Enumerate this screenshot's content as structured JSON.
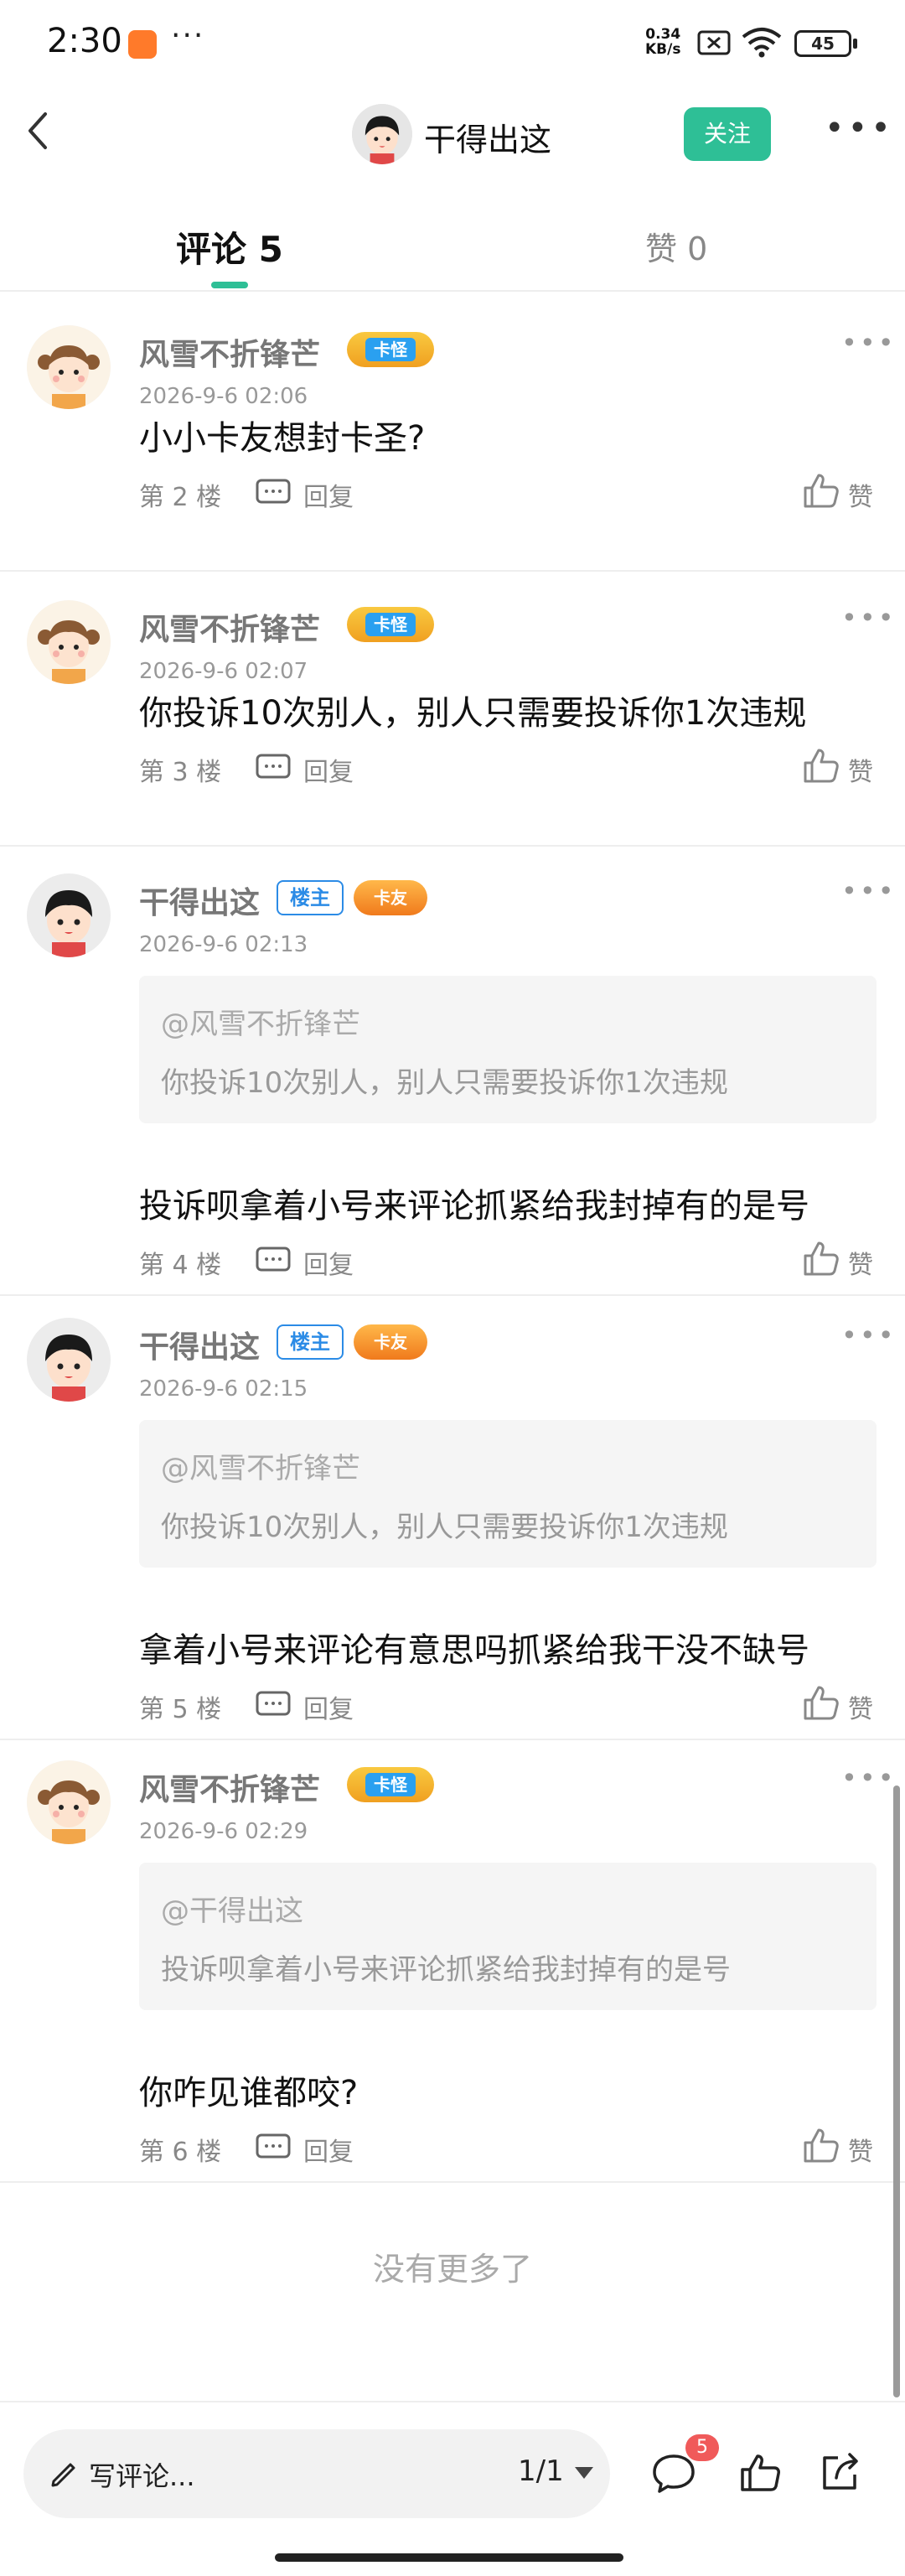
{
  "status_bar": {
    "time": "2:30",
    "dots": "···",
    "net_speed_value": "0.34",
    "net_speed_unit": "KB/s",
    "battery": "45"
  },
  "header": {
    "title": "干得出这",
    "follow_label": "关注",
    "more": "•••"
  },
  "tabs": {
    "comments_label": "评论",
    "comments_count": "5",
    "likes_label": "赞",
    "likes_count": "0"
  },
  "comments": [
    {
      "user": "风雪不折锋芒",
      "is_owner": false,
      "medal": "卡怪",
      "time": "2026-9-6 02:06",
      "quote": null,
      "text": "小小卡友想封卡圣?",
      "floor": "第 2 楼",
      "reply_label": "回复",
      "like_label": "赞"
    },
    {
      "user": "风雪不折锋芒",
      "is_owner": false,
      "medal": "卡怪",
      "time": "2026-9-6 02:07",
      "quote": null,
      "text": "你投诉10次别人，别人只需要投诉你1次违规",
      "floor": "第 3 楼",
      "reply_label": "回复",
      "like_label": "赞"
    },
    {
      "user": "干得出这",
      "is_owner": true,
      "owner_label": "楼主",
      "medal": "卡友",
      "time": "2026-9-6 02:13",
      "quote": {
        "user": "@风雪不折锋芒",
        "text": "你投诉10次别人，别人只需要投诉你1次违规"
      },
      "text": "投诉呗拿着小号来评论抓紧给我封掉有的是号",
      "floor": "第 4 楼",
      "reply_label": "回复",
      "like_label": "赞"
    },
    {
      "user": "干得出这",
      "is_owner": true,
      "owner_label": "楼主",
      "medal": "卡友",
      "time": "2026-9-6 02:15",
      "quote": {
        "user": "@风雪不折锋芒",
        "text": "你投诉10次别人，别人只需要投诉你1次违规"
      },
      "text": "拿着小号来评论有意思吗抓紧给我干没不缺号",
      "floor": "第 5 楼",
      "reply_label": "回复",
      "like_label": "赞"
    },
    {
      "user": "风雪不折锋芒",
      "is_owner": false,
      "medal": "卡怪",
      "time": "2026-9-6 02:29",
      "quote": {
        "user": "@干得出这",
        "text": "投诉呗拿着小号来评论抓紧给我封掉有的是号"
      },
      "text": "你咋见谁都咬?",
      "floor": "第 6 楼",
      "reply_label": "回复",
      "like_label": "赞"
    }
  ],
  "no_more": "没有更多了",
  "bottom_bar": {
    "write_placeholder": "写评论...",
    "page_indicator": "1/1",
    "comment_badge": "5"
  },
  "colors": {
    "accent": "#2ebf96",
    "owner_badge": "#2b8be6",
    "notification": "#f05a5a"
  },
  "icons": [
    "back-icon",
    "more-icon",
    "reply-icon",
    "like-icon",
    "pen-icon",
    "dropdown-icon",
    "comment-icon",
    "share-icon",
    "wifi-icon",
    "sim-icon",
    "battery-icon"
  ]
}
